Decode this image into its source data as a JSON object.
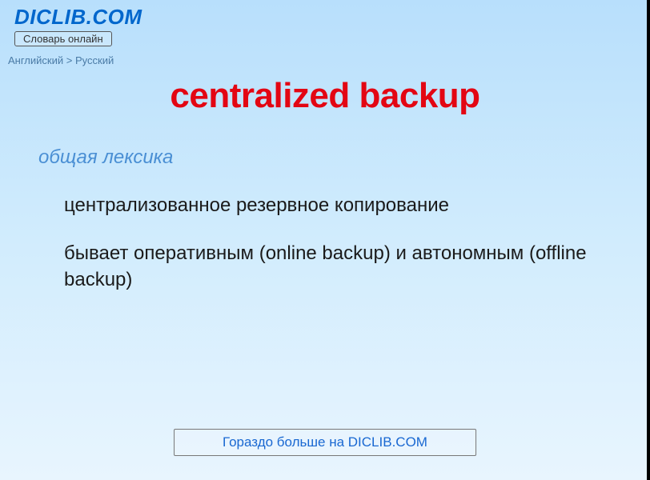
{
  "header": {
    "site_title": "DICLIB.COM",
    "subtitle": "Словарь онлайн"
  },
  "breadcrumb": {
    "from": "Английский",
    "separator": ">",
    "to": "Русский"
  },
  "entry": {
    "term": "centralized backup",
    "category": "общая лексика",
    "definitions": [
      "централизованное резервное копирование",
      "бывает оперативным (online backup) и автономным (offline backup)"
    ]
  },
  "footer": {
    "more_link": "Гораздо больше на DICLIB.COM"
  }
}
